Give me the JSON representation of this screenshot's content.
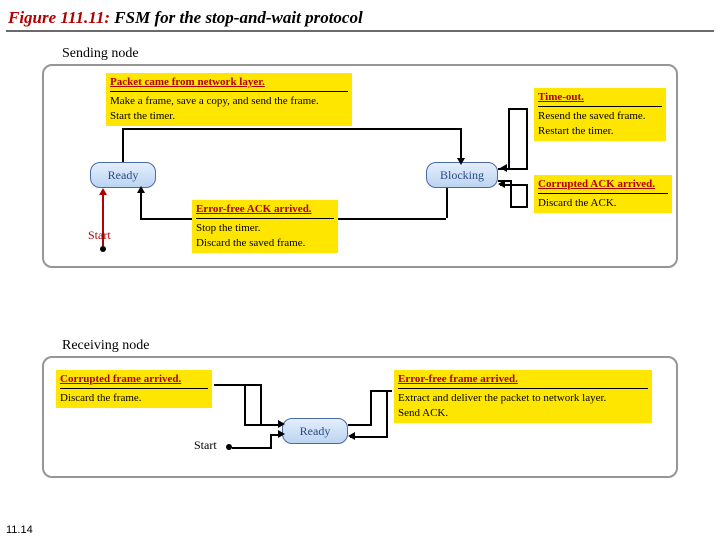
{
  "title": {
    "fig": "Figure 111.11:",
    "rest": "  FSM for  the stop-and-wait protocol"
  },
  "sending": {
    "label": "Sending node",
    "ready": "Ready",
    "blocking": "Blocking",
    "start": "Start",
    "box1": {
      "ev": "Packet came from network layer.",
      "a1": "Make a frame, save a copy, and send the frame.",
      "a2": "Start the timer."
    },
    "box2": {
      "ev": "Time-out.",
      "a1": "Resend the saved frame.",
      "a2": "Restart the timer."
    },
    "box3": {
      "ev": "Corrupted ACK arrived.",
      "a1": "Discard the ACK."
    },
    "box4": {
      "ev": "Error-free ACK arrived.",
      "a1": "Stop the timer.",
      "a2": "Discard the saved frame."
    }
  },
  "receiving": {
    "label": "Receiving node",
    "ready": "Ready",
    "start": "Start",
    "box1": {
      "ev": "Corrupted frame arrived.",
      "a1": "Discard the frame."
    },
    "box2": {
      "ev": "Error-free frame arrived.",
      "a1": "Extract and deliver the packet to network layer.",
      "a2": "Send ACK."
    }
  },
  "footer": "11.14",
  "chart_data": {
    "type": "table",
    "title": "FSM for the stop-and-wait protocol",
    "machines": [
      {
        "name": "Sending node",
        "initial": "Ready",
        "states": [
          "Ready",
          "Blocking"
        ],
        "transitions": [
          {
            "from": "Ready",
            "to": "Blocking",
            "event": "Packet came from network layer.",
            "actions": [
              "Make a frame, save a copy, and send the frame.",
              "Start the timer."
            ]
          },
          {
            "from": "Blocking",
            "to": "Blocking",
            "event": "Time-out.",
            "actions": [
              "Resend the saved frame.",
              "Restart the timer."
            ]
          },
          {
            "from": "Blocking",
            "to": "Blocking",
            "event": "Corrupted ACK arrived.",
            "actions": [
              "Discard the ACK."
            ]
          },
          {
            "from": "Blocking",
            "to": "Ready",
            "event": "Error-free ACK arrived.",
            "actions": [
              "Stop the timer.",
              "Discard the saved frame."
            ]
          }
        ]
      },
      {
        "name": "Receiving node",
        "initial": "Ready",
        "states": [
          "Ready"
        ],
        "transitions": [
          {
            "from": "Ready",
            "to": "Ready",
            "event": "Corrupted frame arrived.",
            "actions": [
              "Discard the frame."
            ]
          },
          {
            "from": "Ready",
            "to": "Ready",
            "event": "Error-free frame arrived.",
            "actions": [
              "Extract and deliver the packet to network layer.",
              "Send ACK."
            ]
          }
        ]
      }
    ]
  }
}
